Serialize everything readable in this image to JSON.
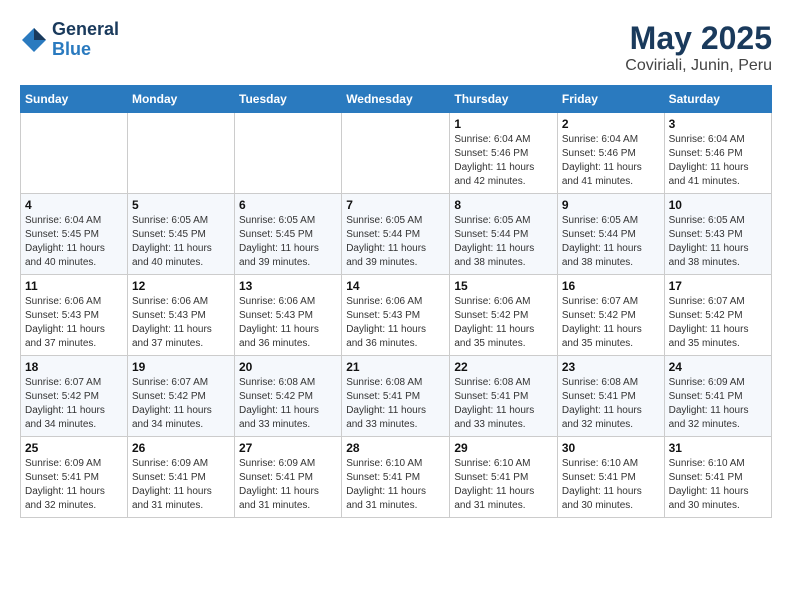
{
  "logo": {
    "general": "General",
    "blue": "Blue"
  },
  "title": "May 2025",
  "subtitle": "Coviriali, Junin, Peru",
  "days_header": [
    "Sunday",
    "Monday",
    "Tuesday",
    "Wednesday",
    "Thursday",
    "Friday",
    "Saturday"
  ],
  "weeks": [
    [
      {
        "day": "",
        "info": ""
      },
      {
        "day": "",
        "info": ""
      },
      {
        "day": "",
        "info": ""
      },
      {
        "day": "",
        "info": ""
      },
      {
        "day": "1",
        "info": "Sunrise: 6:04 AM\nSunset: 5:46 PM\nDaylight: 11 hours\nand 42 minutes."
      },
      {
        "day": "2",
        "info": "Sunrise: 6:04 AM\nSunset: 5:46 PM\nDaylight: 11 hours\nand 41 minutes."
      },
      {
        "day": "3",
        "info": "Sunrise: 6:04 AM\nSunset: 5:46 PM\nDaylight: 11 hours\nand 41 minutes."
      }
    ],
    [
      {
        "day": "4",
        "info": "Sunrise: 6:04 AM\nSunset: 5:45 PM\nDaylight: 11 hours\nand 40 minutes."
      },
      {
        "day": "5",
        "info": "Sunrise: 6:05 AM\nSunset: 5:45 PM\nDaylight: 11 hours\nand 40 minutes."
      },
      {
        "day": "6",
        "info": "Sunrise: 6:05 AM\nSunset: 5:45 PM\nDaylight: 11 hours\nand 39 minutes."
      },
      {
        "day": "7",
        "info": "Sunrise: 6:05 AM\nSunset: 5:44 PM\nDaylight: 11 hours\nand 39 minutes."
      },
      {
        "day": "8",
        "info": "Sunrise: 6:05 AM\nSunset: 5:44 PM\nDaylight: 11 hours\nand 38 minutes."
      },
      {
        "day": "9",
        "info": "Sunrise: 6:05 AM\nSunset: 5:44 PM\nDaylight: 11 hours\nand 38 minutes."
      },
      {
        "day": "10",
        "info": "Sunrise: 6:05 AM\nSunset: 5:43 PM\nDaylight: 11 hours\nand 38 minutes."
      }
    ],
    [
      {
        "day": "11",
        "info": "Sunrise: 6:06 AM\nSunset: 5:43 PM\nDaylight: 11 hours\nand 37 minutes."
      },
      {
        "day": "12",
        "info": "Sunrise: 6:06 AM\nSunset: 5:43 PM\nDaylight: 11 hours\nand 37 minutes."
      },
      {
        "day": "13",
        "info": "Sunrise: 6:06 AM\nSunset: 5:43 PM\nDaylight: 11 hours\nand 36 minutes."
      },
      {
        "day": "14",
        "info": "Sunrise: 6:06 AM\nSunset: 5:43 PM\nDaylight: 11 hours\nand 36 minutes."
      },
      {
        "day": "15",
        "info": "Sunrise: 6:06 AM\nSunset: 5:42 PM\nDaylight: 11 hours\nand 35 minutes."
      },
      {
        "day": "16",
        "info": "Sunrise: 6:07 AM\nSunset: 5:42 PM\nDaylight: 11 hours\nand 35 minutes."
      },
      {
        "day": "17",
        "info": "Sunrise: 6:07 AM\nSunset: 5:42 PM\nDaylight: 11 hours\nand 35 minutes."
      }
    ],
    [
      {
        "day": "18",
        "info": "Sunrise: 6:07 AM\nSunset: 5:42 PM\nDaylight: 11 hours\nand 34 minutes."
      },
      {
        "day": "19",
        "info": "Sunrise: 6:07 AM\nSunset: 5:42 PM\nDaylight: 11 hours\nand 34 minutes."
      },
      {
        "day": "20",
        "info": "Sunrise: 6:08 AM\nSunset: 5:42 PM\nDaylight: 11 hours\nand 33 minutes."
      },
      {
        "day": "21",
        "info": "Sunrise: 6:08 AM\nSunset: 5:41 PM\nDaylight: 11 hours\nand 33 minutes."
      },
      {
        "day": "22",
        "info": "Sunrise: 6:08 AM\nSunset: 5:41 PM\nDaylight: 11 hours\nand 33 minutes."
      },
      {
        "day": "23",
        "info": "Sunrise: 6:08 AM\nSunset: 5:41 PM\nDaylight: 11 hours\nand 32 minutes."
      },
      {
        "day": "24",
        "info": "Sunrise: 6:09 AM\nSunset: 5:41 PM\nDaylight: 11 hours\nand 32 minutes."
      }
    ],
    [
      {
        "day": "25",
        "info": "Sunrise: 6:09 AM\nSunset: 5:41 PM\nDaylight: 11 hours\nand 32 minutes."
      },
      {
        "day": "26",
        "info": "Sunrise: 6:09 AM\nSunset: 5:41 PM\nDaylight: 11 hours\nand 31 minutes."
      },
      {
        "day": "27",
        "info": "Sunrise: 6:09 AM\nSunset: 5:41 PM\nDaylight: 11 hours\nand 31 minutes."
      },
      {
        "day": "28",
        "info": "Sunrise: 6:10 AM\nSunset: 5:41 PM\nDaylight: 11 hours\nand 31 minutes."
      },
      {
        "day": "29",
        "info": "Sunrise: 6:10 AM\nSunset: 5:41 PM\nDaylight: 11 hours\nand 31 minutes."
      },
      {
        "day": "30",
        "info": "Sunrise: 6:10 AM\nSunset: 5:41 PM\nDaylight: 11 hours\nand 30 minutes."
      },
      {
        "day": "31",
        "info": "Sunrise: 6:10 AM\nSunset: 5:41 PM\nDaylight: 11 hours\nand 30 minutes."
      }
    ]
  ]
}
